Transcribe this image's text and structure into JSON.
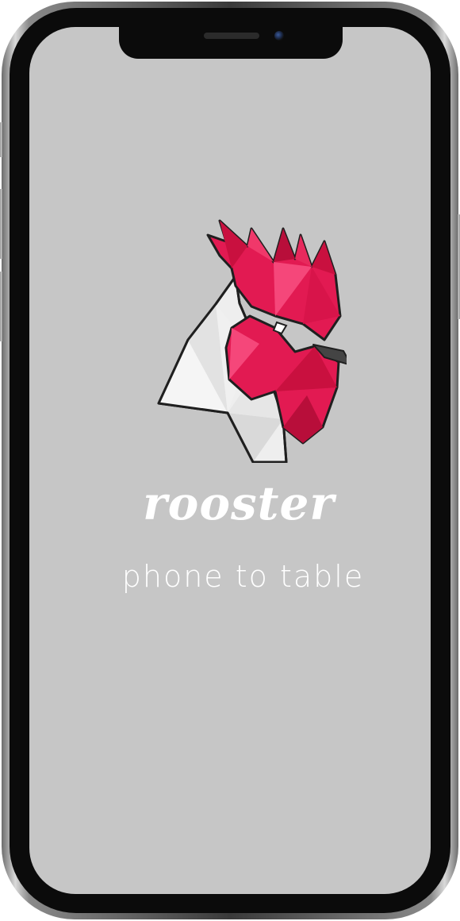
{
  "splash": {
    "app_name": "rooster",
    "tagline": "phone to table",
    "logo_icon": "rooster-head-icon"
  },
  "colors": {
    "background": "#c6c6c6",
    "brand_red": "#e21a52",
    "text": "#ffffff"
  }
}
